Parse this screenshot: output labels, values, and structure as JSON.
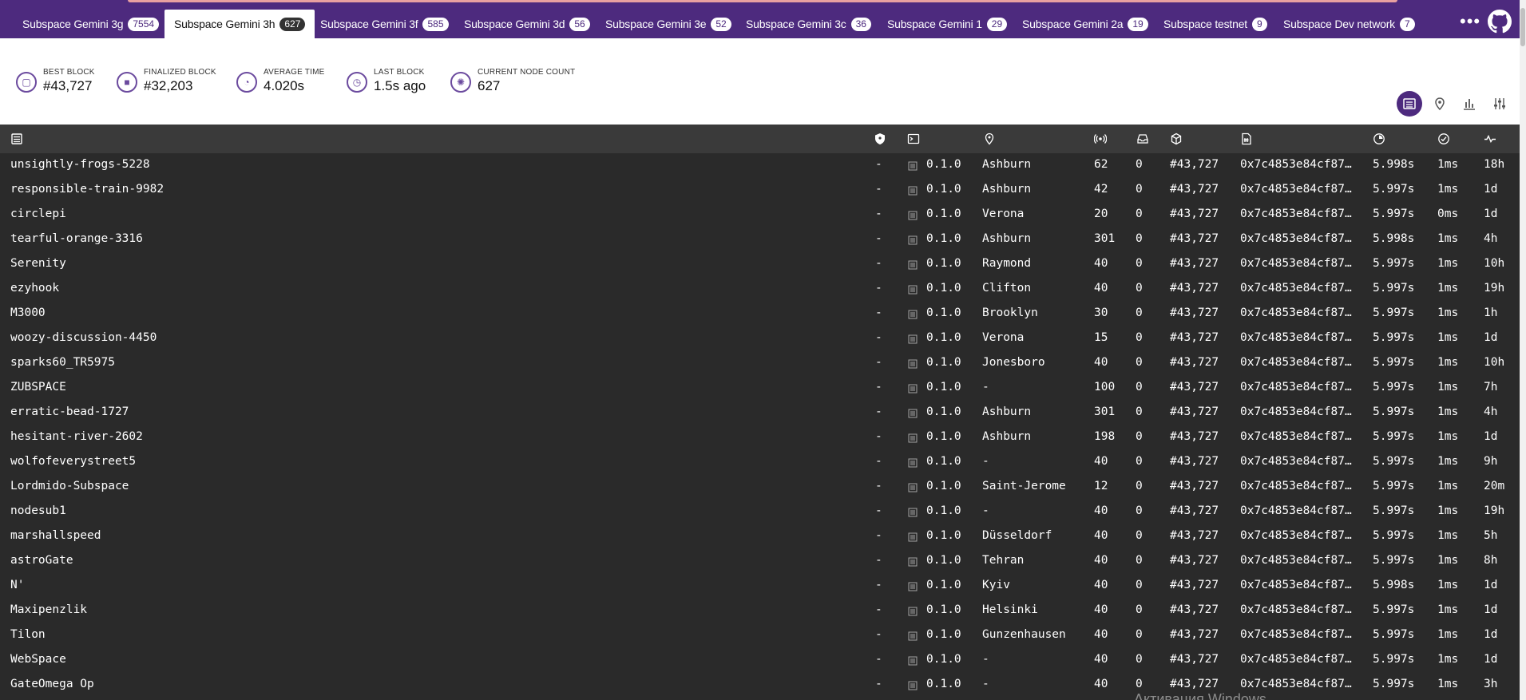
{
  "tabs": [
    {
      "label": "Subspace Gemini 3g",
      "count": "7554",
      "active": false
    },
    {
      "label": "Subspace Gemini 3h",
      "count": "627",
      "active": true
    },
    {
      "label": "Subspace Gemini 3f",
      "count": "585",
      "active": false
    },
    {
      "label": "Subspace Gemini 3d",
      "count": "56",
      "active": false
    },
    {
      "label": "Subspace Gemini 3e",
      "count": "52",
      "active": false
    },
    {
      "label": "Subspace Gemini 3c",
      "count": "36",
      "active": false
    },
    {
      "label": "Subspace Gemini 1",
      "count": "29",
      "active": false
    },
    {
      "label": "Subspace Gemini 2a",
      "count": "19",
      "active": false
    },
    {
      "label": "Subspace testnet",
      "count": "9",
      "active": false
    },
    {
      "label": "Subspace Dev network",
      "count": "7",
      "active": false
    }
  ],
  "more_menu": "•••",
  "stats": [
    {
      "title": "Best Block",
      "value": "#43,727",
      "icon": "cube-icon"
    },
    {
      "title": "Finalized Block",
      "value": "#32,203",
      "icon": "finalized-cube-icon"
    },
    {
      "title": "Average Time",
      "value": "4.020s",
      "icon": "timer-icon"
    },
    {
      "title": "Last Block",
      "value": "1.5s ago",
      "icon": "stopwatch-icon"
    },
    {
      "title": "Current Node Count",
      "value": "627",
      "icon": "nodes-icon"
    }
  ],
  "view_buttons": [
    "list-view-icon",
    "map-view-icon",
    "stats-view-icon",
    "settings-icon"
  ],
  "table": {
    "columns": [
      "node-name-icon",
      "validator-icon",
      "implementation-icon",
      "location-icon",
      "peers-icon",
      "transactions-icon",
      "block-icon",
      "block-hash-icon",
      "block-time-icon",
      "propagation-icon",
      "uptime-icon"
    ],
    "rows": [
      {
        "name": "unsightly-frogs-5228",
        "validator": "-",
        "version": "0.1.0",
        "location": "Ashburn",
        "peers": "62",
        "txs": "0",
        "block": "#43,727",
        "hash": "0x7c4853e84cf87…",
        "block_time": "5.998s",
        "propagation": "1ms",
        "uptime": "18h"
      },
      {
        "name": "responsible-train-9982",
        "validator": "-",
        "version": "0.1.0",
        "location": "Ashburn",
        "peers": "42",
        "txs": "0",
        "block": "#43,727",
        "hash": "0x7c4853e84cf87…",
        "block_time": "5.997s",
        "propagation": "1ms",
        "uptime": "1d"
      },
      {
        "name": "circlepi",
        "validator": "-",
        "version": "0.1.0",
        "location": "Verona",
        "peers": "20",
        "txs": "0",
        "block": "#43,727",
        "hash": "0x7c4853e84cf87…",
        "block_time": "5.997s",
        "propagation": "0ms",
        "uptime": "1d"
      },
      {
        "name": "tearful-orange-3316",
        "validator": "-",
        "version": "0.1.0",
        "location": "Ashburn",
        "peers": "301",
        "txs": "0",
        "block": "#43,727",
        "hash": "0x7c4853e84cf87…",
        "block_time": "5.998s",
        "propagation": "1ms",
        "uptime": "4h"
      },
      {
        "name": "Serenity",
        "validator": "-",
        "version": "0.1.0",
        "location": "Raymond",
        "peers": "40",
        "txs": "0",
        "block": "#43,727",
        "hash": "0x7c4853e84cf87…",
        "block_time": "5.997s",
        "propagation": "1ms",
        "uptime": "10h"
      },
      {
        "name": "ezyhook",
        "validator": "-",
        "version": "0.1.0",
        "location": "Clifton",
        "peers": "40",
        "txs": "0",
        "block": "#43,727",
        "hash": "0x7c4853e84cf87…",
        "block_time": "5.997s",
        "propagation": "1ms",
        "uptime": "19h"
      },
      {
        "name": "M3000",
        "validator": "-",
        "version": "0.1.0",
        "location": "Brooklyn",
        "peers": "30",
        "txs": "0",
        "block": "#43,727",
        "hash": "0x7c4853e84cf87…",
        "block_time": "5.997s",
        "propagation": "1ms",
        "uptime": "1h"
      },
      {
        "name": "woozy-discussion-4450",
        "validator": "-",
        "version": "0.1.0",
        "location": "Verona",
        "peers": "15",
        "txs": "0",
        "block": "#43,727",
        "hash": "0x7c4853e84cf87…",
        "block_time": "5.997s",
        "propagation": "1ms",
        "uptime": "1d"
      },
      {
        "name": "sparks60_TR5975",
        "validator": "-",
        "version": "0.1.0",
        "location": "Jonesboro",
        "peers": "40",
        "txs": "0",
        "block": "#43,727",
        "hash": "0x7c4853e84cf87…",
        "block_time": "5.997s",
        "propagation": "1ms",
        "uptime": "10h"
      },
      {
        "name": "ZUBSPACE",
        "validator": "-",
        "version": "0.1.0",
        "location": "-",
        "peers": "100",
        "txs": "0",
        "block": "#43,727",
        "hash": "0x7c4853e84cf87…",
        "block_time": "5.997s",
        "propagation": "1ms",
        "uptime": "7h"
      },
      {
        "name": "erratic-bead-1727",
        "validator": "-",
        "version": "0.1.0",
        "location": "Ashburn",
        "peers": "301",
        "txs": "0",
        "block": "#43,727",
        "hash": "0x7c4853e84cf87…",
        "block_time": "5.997s",
        "propagation": "1ms",
        "uptime": "4h"
      },
      {
        "name": "hesitant-river-2602",
        "validator": "-",
        "version": "0.1.0",
        "location": "Ashburn",
        "peers": "198",
        "txs": "0",
        "block": "#43,727",
        "hash": "0x7c4853e84cf87…",
        "block_time": "5.997s",
        "propagation": "1ms",
        "uptime": "1d"
      },
      {
        "name": "wolfofeverystreet5",
        "validator": "-",
        "version": "0.1.0",
        "location": "-",
        "peers": "40",
        "txs": "0",
        "block": "#43,727",
        "hash": "0x7c4853e84cf87…",
        "block_time": "5.997s",
        "propagation": "1ms",
        "uptime": "9h"
      },
      {
        "name": "Lordmido-Subspace",
        "validator": "-",
        "version": "0.1.0",
        "location": "Saint-Jerome",
        "peers": "12",
        "txs": "0",
        "block": "#43,727",
        "hash": "0x7c4853e84cf87…",
        "block_time": "5.997s",
        "propagation": "1ms",
        "uptime": "20m"
      },
      {
        "name": "nodesub1",
        "validator": "-",
        "version": "0.1.0",
        "location": "-",
        "peers": "40",
        "txs": "0",
        "block": "#43,727",
        "hash": "0x7c4853e84cf87…",
        "block_time": "5.997s",
        "propagation": "1ms",
        "uptime": "19h"
      },
      {
        "name": "marshallspeed",
        "validator": "-",
        "version": "0.1.0",
        "location": "Düsseldorf",
        "peers": "40",
        "txs": "0",
        "block": "#43,727",
        "hash": "0x7c4853e84cf87…",
        "block_time": "5.997s",
        "propagation": "1ms",
        "uptime": "5h"
      },
      {
        "name": "astroGate",
        "validator": "-",
        "version": "0.1.0",
        "location": "Tehran",
        "peers": "40",
        "txs": "0",
        "block": "#43,727",
        "hash": "0x7c4853e84cf87…",
        "block_time": "5.997s",
        "propagation": "1ms",
        "uptime": "8h"
      },
      {
        "name": "N'",
        "validator": "-",
        "version": "0.1.0",
        "location": "Kyiv",
        "peers": "40",
        "txs": "0",
        "block": "#43,727",
        "hash": "0x7c4853e84cf87…",
        "block_time": "5.998s",
        "propagation": "1ms",
        "uptime": "1d"
      },
      {
        "name": "Maxipenzlik",
        "validator": "-",
        "version": "0.1.0",
        "location": "Helsinki",
        "peers": "40",
        "txs": "0",
        "block": "#43,727",
        "hash": "0x7c4853e84cf87…",
        "block_time": "5.997s",
        "propagation": "1ms",
        "uptime": "1d"
      },
      {
        "name": "Tilon",
        "validator": "-",
        "version": "0.1.0",
        "location": "Gunzenhausen",
        "peers": "40",
        "txs": "0",
        "block": "#43,727",
        "hash": "0x7c4853e84cf87…",
        "block_time": "5.997s",
        "propagation": "1ms",
        "uptime": "1d"
      },
      {
        "name": "WebSpace",
        "validator": "-",
        "version": "0.1.0",
        "location": "-",
        "peers": "40",
        "txs": "0",
        "block": "#43,727",
        "hash": "0x7c4853e84cf87…",
        "block_time": "5.997s",
        "propagation": "1ms",
        "uptime": "1d"
      },
      {
        "name": "GateOmega Op",
        "validator": "-",
        "version": "0.1.0",
        "location": "-",
        "peers": "40",
        "txs": "0",
        "block": "#43,727",
        "hash": "0x7c4853e84cf87…",
        "block_time": "5.997s",
        "propagation": "1ms",
        "uptime": "3h"
      }
    ]
  },
  "os_watermark": "Активация Windows",
  "colors": {
    "brand": "#4d2a7e",
    "table_bg": "#2a2a2a",
    "table_header_bg": "#3a3a3a"
  }
}
